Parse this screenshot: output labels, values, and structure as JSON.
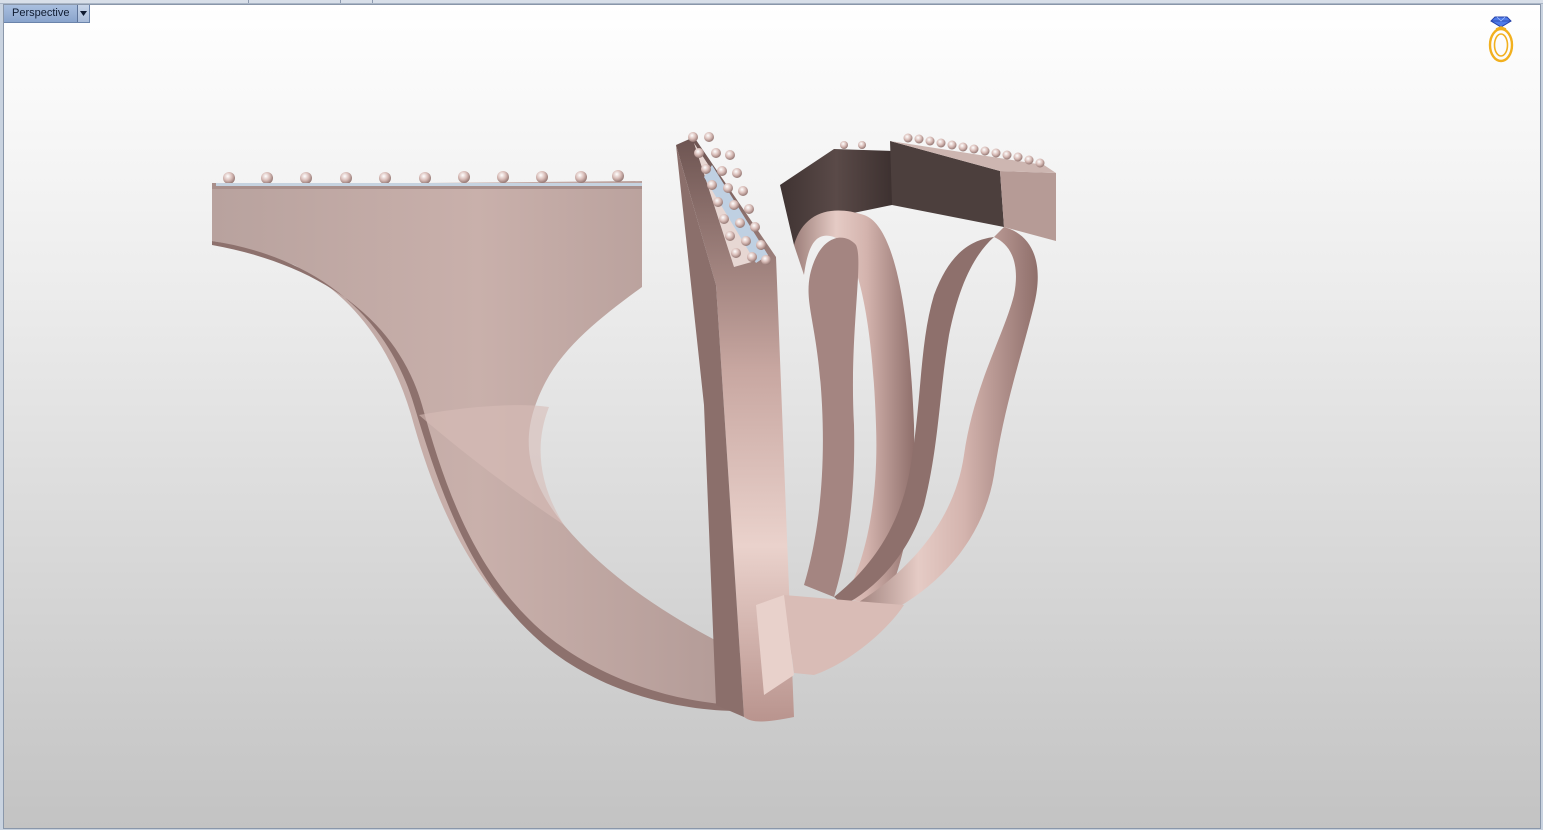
{
  "viewport": {
    "title": "Perspective",
    "dropdown_icon": "chevron-down-icon"
  },
  "logo": {
    "icon": "ring-gem-logo-icon",
    "gem_color": "#3a5fd9",
    "band_color": "#f2b01e"
  },
  "model": {
    "name": "ring-3d-model",
    "metal_color": "#c9a59f",
    "shadow_color": "#4a3d3b"
  },
  "window_colors": {
    "frame": "#c9d3e0",
    "label_bg": "#8fa9cf"
  }
}
